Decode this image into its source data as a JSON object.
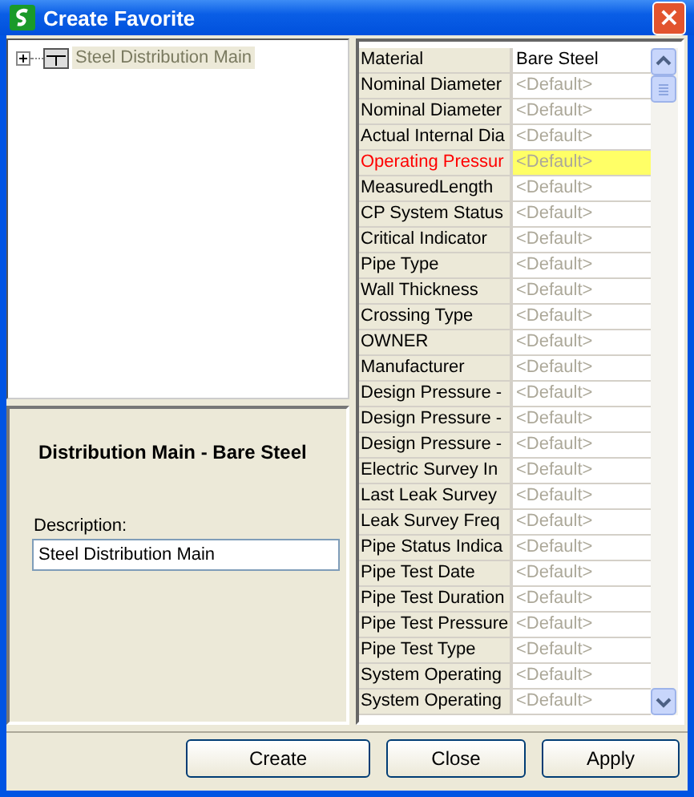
{
  "window": {
    "title": "Create Favorite",
    "close": "×"
  },
  "tree": {
    "items": [
      {
        "label": "Steel Distribution Main",
        "expanded": false,
        "selected": true
      }
    ]
  },
  "details": {
    "heading": "Distribution Main - Bare Steel",
    "description_label": "Description:",
    "description_value": "Steel Distribution Main"
  },
  "properties": [
    {
      "name": "Material",
      "value": "Bare Steel",
      "kind": "set",
      "highlighted": false
    },
    {
      "name": "Nominal Diameter",
      "value": "<Default>",
      "kind": "default",
      "highlighted": false
    },
    {
      "name": "Nominal Diameter",
      "value": "<Default>",
      "kind": "default",
      "highlighted": false
    },
    {
      "name": "Actual Internal Dia",
      "value": "<Default>",
      "kind": "default",
      "highlighted": false
    },
    {
      "name": "Operating Pressur",
      "value": "<Default>",
      "kind": "default",
      "highlighted": true
    },
    {
      "name": "MeasuredLength",
      "value": "<Default>",
      "kind": "default",
      "highlighted": false
    },
    {
      "name": "CP System Status",
      "value": "<Default>",
      "kind": "default",
      "highlighted": false
    },
    {
      "name": "Critical Indicator",
      "value": "<Default>",
      "kind": "default",
      "highlighted": false
    },
    {
      "name": "Pipe Type",
      "value": "<Default>",
      "kind": "default",
      "highlighted": false
    },
    {
      "name": "Wall Thickness",
      "value": "<Default>",
      "kind": "default",
      "highlighted": false
    },
    {
      "name": "Crossing Type",
      "value": "<Default>",
      "kind": "default",
      "highlighted": false
    },
    {
      "name": "OWNER",
      "value": "<Default>",
      "kind": "default",
      "highlighted": false
    },
    {
      "name": "Manufacturer",
      "value": "<Default>",
      "kind": "default",
      "highlighted": false
    },
    {
      "name": "Design Pressure -",
      "value": "<Default>",
      "kind": "default",
      "highlighted": false
    },
    {
      "name": "Design Pressure -",
      "value": "<Default>",
      "kind": "default",
      "highlighted": false
    },
    {
      "name": "Design Pressure -",
      "value": "<Default>",
      "kind": "default",
      "highlighted": false
    },
    {
      "name": "Electric Survey In",
      "value": "<Default>",
      "kind": "default",
      "highlighted": false
    },
    {
      "name": "Last Leak Survey",
      "value": "<Default>",
      "kind": "default",
      "highlighted": false
    },
    {
      "name": "Leak Survey Freq",
      "value": "<Default>",
      "kind": "default",
      "highlighted": false
    },
    {
      "name": "Pipe Status Indica",
      "value": "<Default>",
      "kind": "default",
      "highlighted": false
    },
    {
      "name": "Pipe Test Date",
      "value": "<Default>",
      "kind": "default",
      "highlighted": false
    },
    {
      "name": "Pipe Test Duration",
      "value": "<Default>",
      "kind": "default",
      "highlighted": false
    },
    {
      "name": "Pipe Test Pressure",
      "value": "<Default>",
      "kind": "default",
      "highlighted": false
    },
    {
      "name": "Pipe Test Type",
      "value": "<Default>",
      "kind": "default",
      "highlighted": false
    },
    {
      "name": "System Operating",
      "value": "<Default>",
      "kind": "default",
      "highlighted": false
    },
    {
      "name": "System Operating",
      "value": "<Default>",
      "kind": "default",
      "highlighted": false
    }
  ],
  "buttons": [
    "Create",
    "Close",
    "Apply"
  ]
}
